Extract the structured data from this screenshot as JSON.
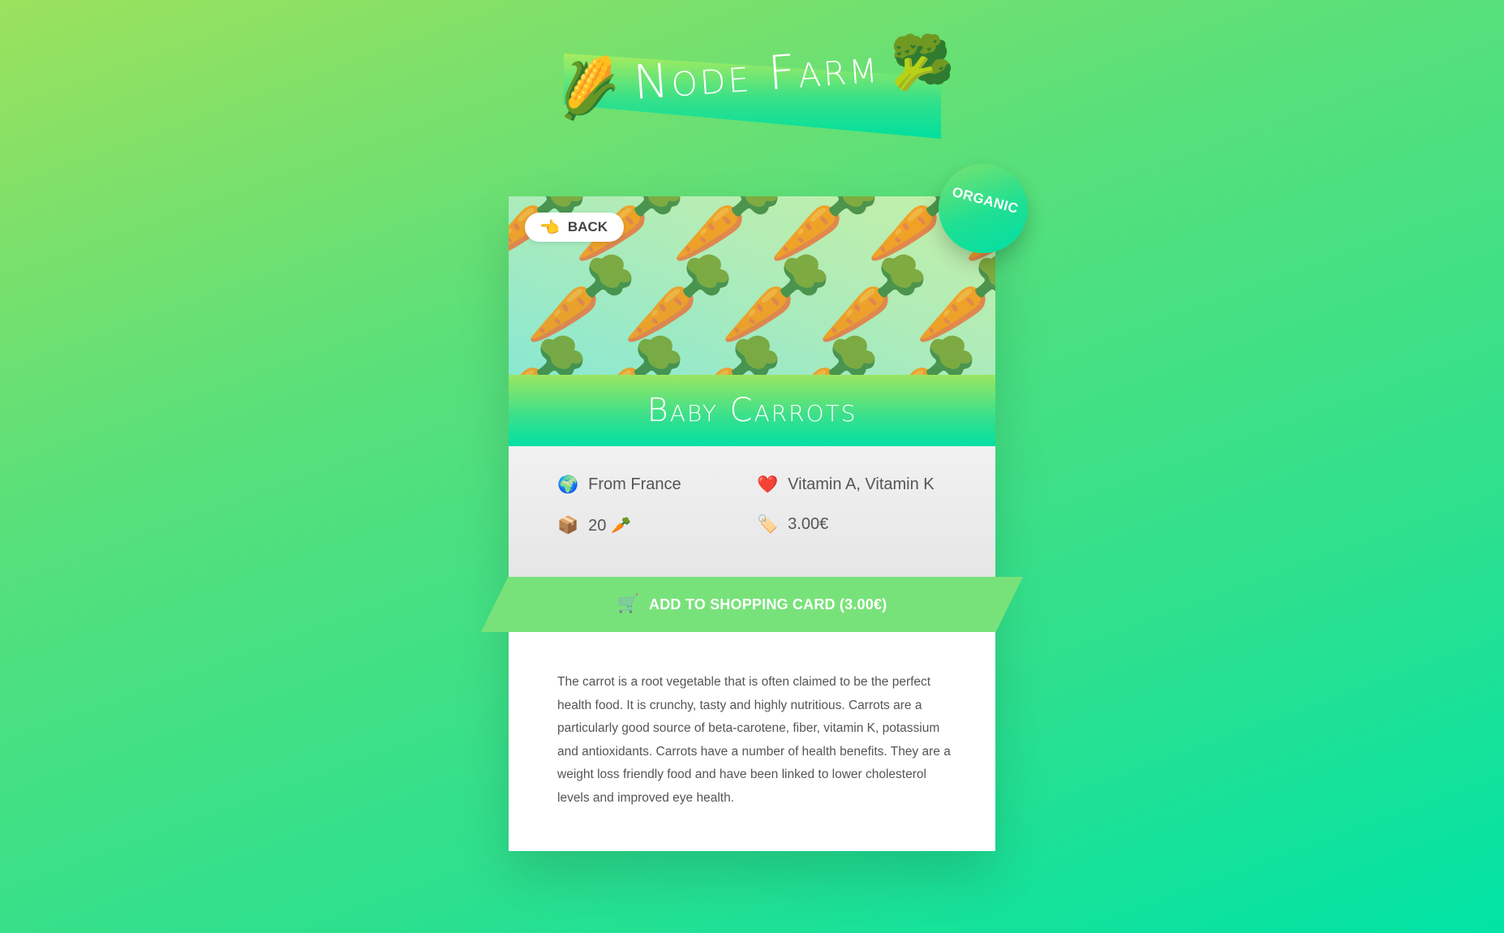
{
  "header": {
    "title": "Node Farm",
    "left_icon": "🌽",
    "left_icon_name": "corn-icon",
    "right_icon": "🥦",
    "right_icon_name": "broccoli-icon"
  },
  "product": {
    "image_emoji": "🥕",
    "image_name": "carrot-pattern",
    "back": {
      "icon": "👈",
      "label": "BACK"
    },
    "badge": "ORGANIC",
    "name": "Baby Carrots",
    "details": {
      "origin": {
        "icon": "🌍",
        "text": "From France"
      },
      "nutrients": {
        "icon": "❤️",
        "text": "Vitamin A, Vitamin K"
      },
      "quantity": {
        "icon": "📦",
        "text": "20 🥕"
      },
      "price": {
        "icon": "🏷️",
        "text": "3.00€"
      }
    },
    "add_to_cart": {
      "icon": "🛒",
      "label": "ADD TO SHOPPING CARD (3.00€)"
    },
    "description": "The carrot is a root vegetable that is often claimed to be the perfect health food. It is crunchy, tasty and highly nutritious. Carrots are a particularly good source of beta-carotene, fiber, vitamin K, potassium and antioxidants. Carrots have a number of health benefits. They are a weight loss friendly food and have been linked to lower cholesterol levels and improved eye health."
  },
  "colors": {
    "background_start": "#9be15d",
    "background_end": "#00e3a5",
    "button": "#78e27a",
    "text": "#555555"
  }
}
